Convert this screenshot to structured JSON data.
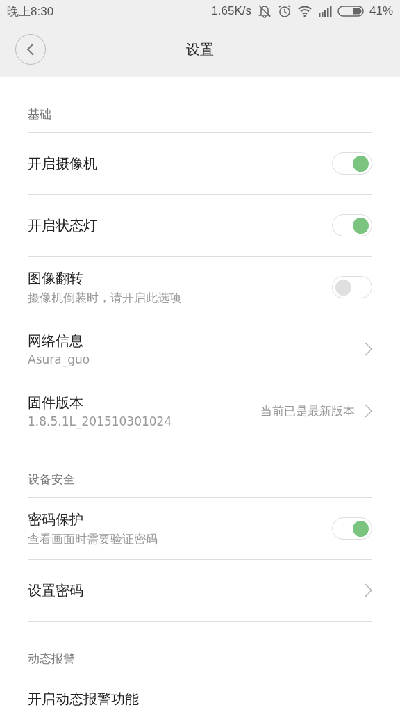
{
  "status_bar": {
    "time": "晚上8:30",
    "speed": "1.65K/s",
    "battery": "41%"
  },
  "header": {
    "title": "设置"
  },
  "sections": [
    {
      "title": "基础",
      "items": [
        {
          "kind": "toggle",
          "title": "开启摄像机",
          "on": true
        },
        {
          "kind": "toggle",
          "title": "开启状态灯",
          "on": true
        },
        {
          "kind": "toggle",
          "title": "图像翻转",
          "subtitle": "摄像机倒装时，请开启此选项",
          "on": false
        },
        {
          "kind": "link",
          "title": "网络信息",
          "subtitle": "Asura_guo"
        },
        {
          "kind": "link",
          "title": "固件版本",
          "subtitle": "1.8.5.1L_201510301024",
          "value": "当前已是最新版本"
        }
      ]
    },
    {
      "title": "设备安全",
      "items": [
        {
          "kind": "toggle",
          "title": "密码保护",
          "subtitle": "查看画面时需要验证密码",
          "on": true
        },
        {
          "kind": "link",
          "title": "设置密码"
        }
      ]
    },
    {
      "title": "动态报警",
      "items": [
        {
          "kind": "plain",
          "title": "开启动态报警功能"
        }
      ]
    }
  ]
}
